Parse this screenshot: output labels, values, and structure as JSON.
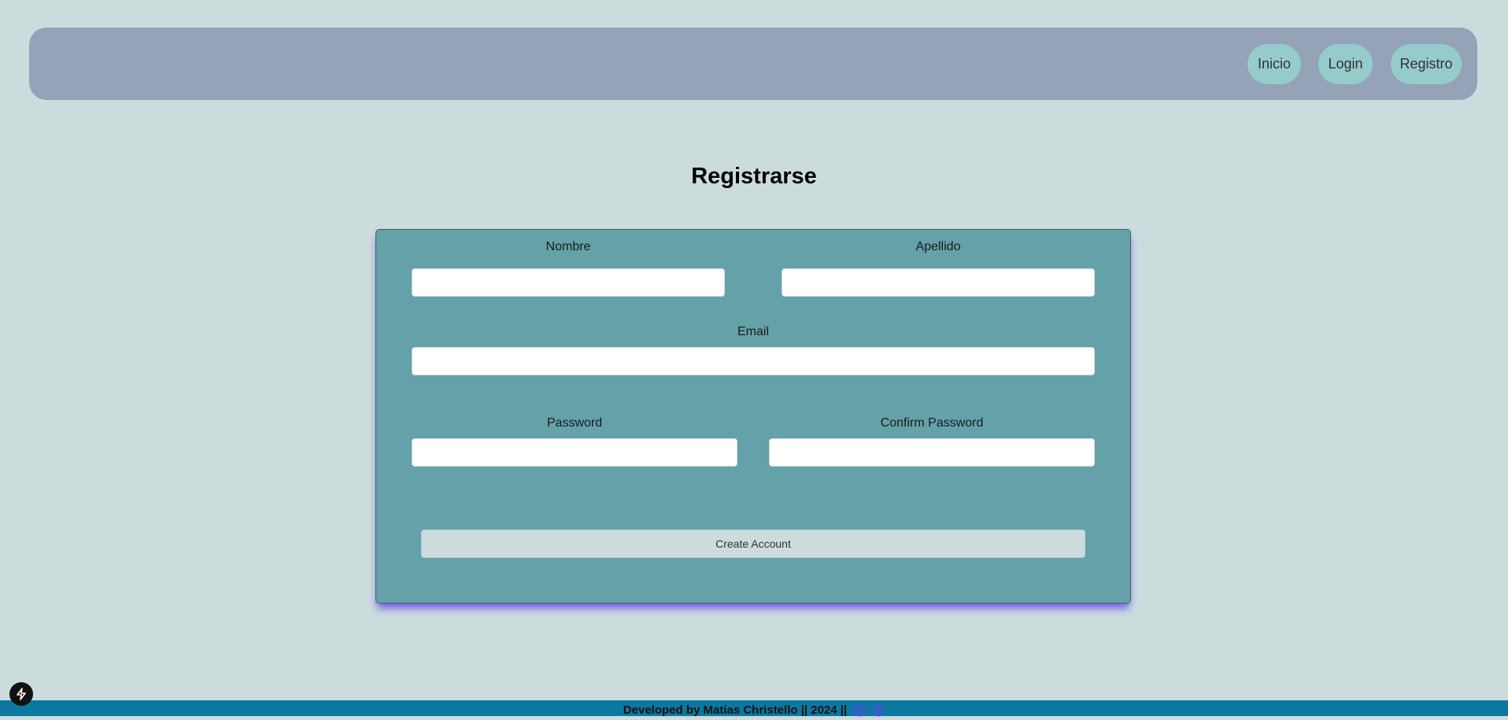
{
  "nav": {
    "links": [
      "Inicio",
      "Login",
      "Registro"
    ]
  },
  "page": {
    "title": "Registrarse"
  },
  "form": {
    "first_name_label": "Nombre",
    "last_name_label": "Apellido",
    "email_label": "Email",
    "password_label": "Password",
    "confirm_password_label": "Confirm Password",
    "first_name_value": "",
    "last_name_value": "",
    "email_value": "",
    "password_value": "",
    "confirm_password_value": "",
    "submit_label": "Create Account"
  },
  "footer": {
    "text": "Developed by Matias Christello || 2024 ||",
    "icons": [
      "github-icon",
      "linkedin-icon"
    ]
  },
  "colors": {
    "background": "#ccdcdd",
    "navbar": "#94a3b8",
    "nav_button": "#96cbcb",
    "card": "#64a1a9",
    "card_shadow": "#5b46eb",
    "footer": "#0c789f"
  }
}
